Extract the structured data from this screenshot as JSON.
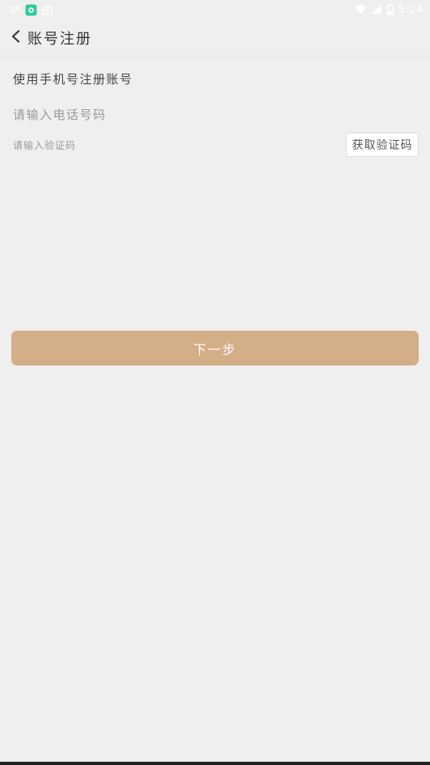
{
  "status_bar": {
    "time": "5:24",
    "left_icons": [
      "signal-alert-icon",
      "app-store-icon",
      "media-icon"
    ],
    "right_icons": [
      "wifi-icon",
      "cell-signal-icon",
      "battery-icon"
    ]
  },
  "header": {
    "title": "账号注册",
    "back_icon": "chevron-left-icon"
  },
  "form": {
    "subtitle": "使用手机号注册账号",
    "phone_placeholder": "请输入电话号码",
    "phone_value": "",
    "code_placeholder": "请输入验证码",
    "code_value": "",
    "get_code_label": "获取验证码",
    "next_label": "下一步"
  },
  "colors": {
    "background": "#efefef",
    "primary_button": "#d4ae86",
    "app_icon": "#2ecc9b"
  }
}
